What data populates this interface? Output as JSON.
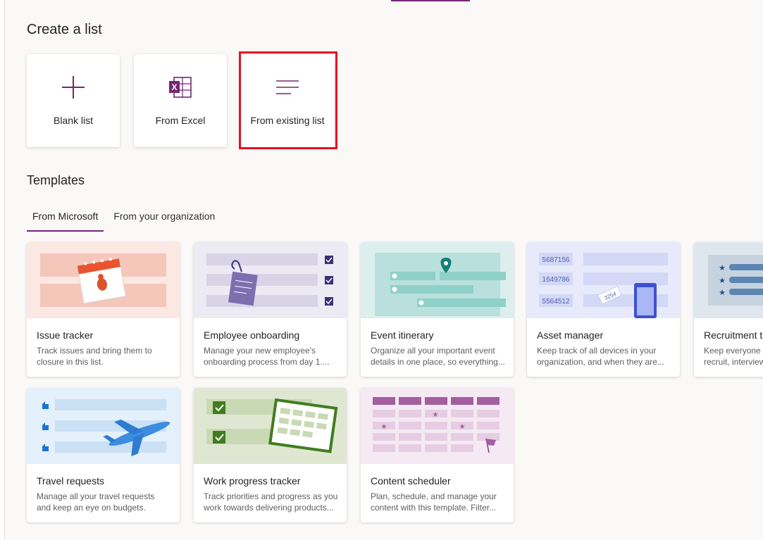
{
  "header": {
    "create_title": "Create a list",
    "templates_title": "Templates"
  },
  "create_options": [
    {
      "label": "Blank list",
      "icon": "plus-icon"
    },
    {
      "label": "From Excel",
      "icon": "excel-icon"
    },
    {
      "label": "From existing list",
      "icon": "list-lines-icon"
    }
  ],
  "tabs": [
    {
      "label": "From Microsoft",
      "active": true
    },
    {
      "label": "From your organization",
      "active": false
    }
  ],
  "templates": [
    {
      "name": "Issue tracker",
      "desc": "Track issues and bring them to\nclosure in this list."
    },
    {
      "name": "Employee onboarding",
      "desc": "Manage your new employee's\nonboarding process from day 1...."
    },
    {
      "name": "Event itinerary",
      "desc": "Organize all your important event\ndetails in one place, so everything..."
    },
    {
      "name": "Asset manager",
      "desc": "Keep track of all devices in your\norganization, and when they are...",
      "art_numbers": [
        "5687156",
        "1649786",
        "5564512",
        "3254"
      ]
    },
    {
      "name": "Recruitment tracker",
      "desc": "Keep everyone informed as you\nrecruit, interview..."
    },
    {
      "name": "Travel requests",
      "desc": "Manage all your travel requests\nand keep an eye on budgets."
    },
    {
      "name": "Work progress tracker",
      "desc": "Track priorities and progress as you\nwork towards delivering products..."
    },
    {
      "name": "Content scheduler",
      "desc": "Plan, schedule, and manage your\ncontent with this template. Filter..."
    }
  ],
  "colors": {
    "accent": "#742774",
    "highlight": "#e81123"
  }
}
